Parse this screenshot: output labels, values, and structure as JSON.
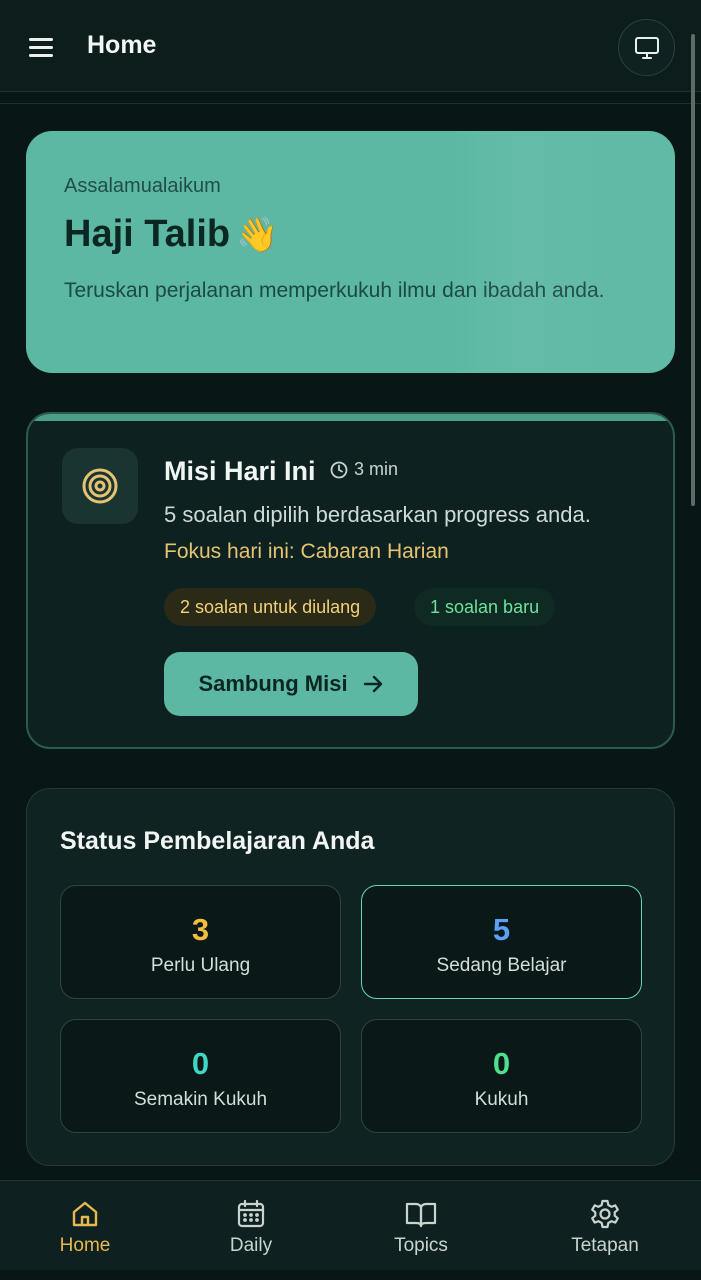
{
  "header": {
    "title": "Home",
    "menu_icon": "menu-icon",
    "action_icon": "monitor-icon"
  },
  "greeting": {
    "salutation": "Assalamualaikum",
    "name": "Haji Talib",
    "emoji": "👋",
    "message": "Teruskan perjalanan memperkukuh ilmu dan ibadah anda.",
    "bg_color": "#5cb8a3"
  },
  "mission": {
    "title": "Misi Hari Ini",
    "duration": "3 min",
    "description": "5 soalan dipilih berdasarkan progress anda.",
    "focus": "Fokus hari ini: Cabaran Harian",
    "review_pill": "2 soalan untuk diulang",
    "new_pill": "1 soalan baru",
    "button_label": "Sambung Misi",
    "icon": "target-icon"
  },
  "status": {
    "title": "Status Pembelajaran Anda",
    "items": [
      {
        "value": "3",
        "label": "Perlu Ulang",
        "color": "#f2bd3f"
      },
      {
        "value": "5",
        "label": "Sedang Belajar",
        "color": "#5aa0f5"
      },
      {
        "value": "0",
        "label": "Semakin Kukuh",
        "color": "#3fd6c3"
      },
      {
        "value": "0",
        "label": "Kukuh",
        "color": "#4fe08f"
      }
    ]
  },
  "nav": {
    "items": [
      {
        "label": "Home",
        "icon": "home-icon",
        "active": true
      },
      {
        "label": "Daily",
        "icon": "calendar-icon",
        "active": false
      },
      {
        "label": "Topics",
        "icon": "book-icon",
        "active": false
      },
      {
        "label": "Tetapan",
        "icon": "gear-icon",
        "active": false
      }
    ],
    "active_color": "#e7b84e"
  }
}
